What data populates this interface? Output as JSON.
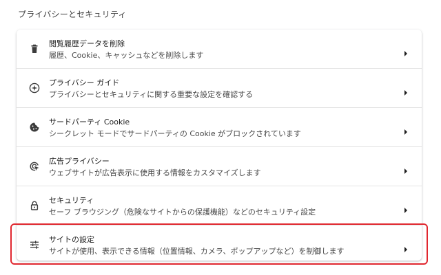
{
  "section_title": "プライバシーとセキュリティ",
  "colors": {
    "highlight": "#e0262e",
    "icon": "#3c3c3c",
    "divider": "#e3e3e3"
  },
  "items": [
    {
      "icon": "trash-icon",
      "title": "閲覧履歴データを削除",
      "description": "履歴、Cookie、キャッシュなどを削除します"
    },
    {
      "icon": "privacy-guide-icon",
      "title": "プライバシー ガイド",
      "description": "プライバシーとセキュリティに関する重要な設定を確認する"
    },
    {
      "icon": "cookie-icon",
      "title": "サードパーティ Cookie",
      "description": "シークレット モードでサードパーティの Cookie がブロックされています"
    },
    {
      "icon": "ad-privacy-icon",
      "title": "広告プライバシー",
      "description": "ウェブサイトが広告表示に使用する情報をカスタマイズします"
    },
    {
      "icon": "lock-icon",
      "title": "セキュリティ",
      "description": "セーフ ブラウジング（危険なサイトからの保護機能）などのセキュリティ設定"
    },
    {
      "icon": "tune-icon",
      "title": "サイトの設定",
      "description": "サイトが使用、表示できる情報（位置情報、カメラ、ポップアップなど）を制御します",
      "highlighted": true
    }
  ]
}
